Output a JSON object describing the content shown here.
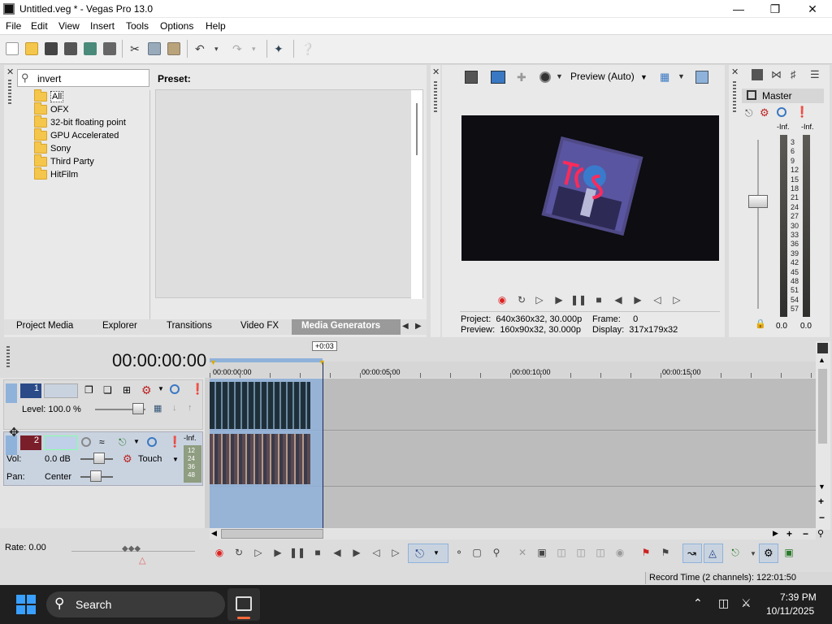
{
  "app": {
    "title": "Untitled.veg * - Vegas Pro 13.0"
  },
  "menu": [
    "File",
    "Edit",
    "View",
    "Insert",
    "Tools",
    "Options",
    "Help"
  ],
  "fx_browser": {
    "search_value": "invert",
    "preset_label": "Preset:",
    "folders": [
      "All",
      "OFX",
      "32-bit floating point",
      "GPU Accelerated",
      "Sony",
      "Third Party",
      "HitFilm"
    ],
    "selected": "All"
  },
  "window_tabs": [
    "Project Media",
    "Explorer",
    "Transitions",
    "Video FX",
    "Media Generators"
  ],
  "active_tab": "Media Generators",
  "preview": {
    "mode": "Preview (Auto)",
    "project_label": "Project:",
    "project_value": "640x360x32, 30.000p",
    "preview_label": "Preview:",
    "preview_value": "160x90x32, 30.000p",
    "frame_label": "Frame:",
    "frame_value": "0",
    "display_label": "Display:",
    "display_value": "317x179x32"
  },
  "mixer": {
    "master_label": "Master",
    "peak_left": "-Inf.",
    "peak_right": "-Inf.",
    "scale": [
      "3",
      "6",
      "9",
      "12",
      "15",
      "18",
      "21",
      "24",
      "27",
      "30",
      "33",
      "36",
      "39",
      "42",
      "45",
      "48",
      "51",
      "54",
      "57"
    ],
    "value_left": "0.0",
    "value_right": "0.0"
  },
  "timeline": {
    "timecode": "00:00:00:00",
    "loop_marker": "+0:03",
    "ruler_labels": [
      "00:00:00:00",
      "00:00:05:00",
      "00:00:10:00",
      "00:00:15:00"
    ],
    "track1": {
      "number": "1",
      "level_label": "Level: 100.0 %"
    },
    "track2": {
      "number": "2",
      "vol_label": "Vol:",
      "vol_value": "0.0 dB",
      "pan_label": "Pan:",
      "pan_value": "Center",
      "automation": "Touch",
      "meter_peak": "-Inf.",
      "meter_scale": [
        "12",
        "24",
        "36",
        "48"
      ]
    },
    "rate": "Rate: 0.00",
    "record_time": "Record Time (2 channels): 122:01:50"
  },
  "taskbar": {
    "search_label": "Search",
    "time": "7:39 PM",
    "date": "10/11/2025"
  },
  "colors": {
    "accent": "#3a78c3",
    "selection": "#8fb2da",
    "track_header": "#c9d3e0"
  }
}
